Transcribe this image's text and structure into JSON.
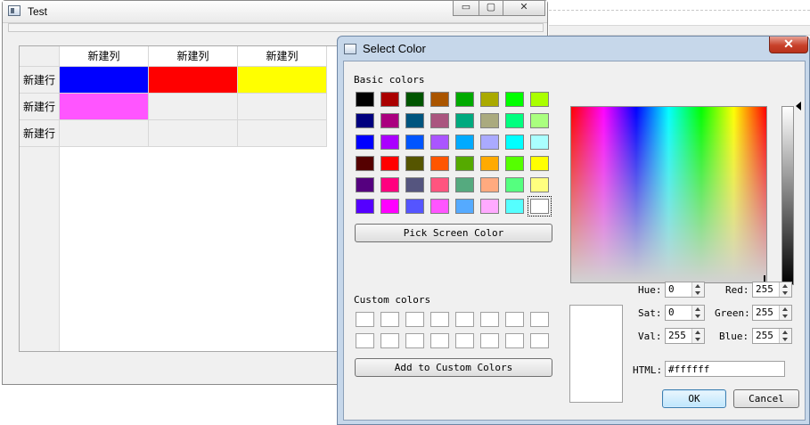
{
  "main_window": {
    "title": "Test",
    "controls": {
      "minimize": "▭",
      "maximize": "▢",
      "close": "✕"
    },
    "table": {
      "columns": [
        "新建列",
        "新建列",
        "新建列"
      ],
      "rows": [
        {
          "label": "新建行",
          "cells": [
            "#0000ff",
            "#ff0000",
            "#ffff00"
          ]
        },
        {
          "label": "新建行",
          "cells": [
            "#ff55ff",
            "",
            ""
          ]
        },
        {
          "label": "新建行",
          "cells": [
            "",
            "",
            ""
          ]
        }
      ]
    }
  },
  "dialog": {
    "title": "Select Color",
    "close": "✕",
    "basic_colors_label": "Basic colors",
    "basic_colors": [
      "#000000",
      "#aa0000",
      "#005500",
      "#aa5500",
      "#00aa00",
      "#aaaa00",
      "#00ff00",
      "#aaff00",
      "#00007f",
      "#aa007f",
      "#00557f",
      "#aa557f",
      "#00aa7f",
      "#aaaa7f",
      "#00ff7f",
      "#aaff7f",
      "#0000ff",
      "#aa00ff",
      "#0055ff",
      "#aa55ff",
      "#00aaff",
      "#aaaaff",
      "#00ffff",
      "#aaffff",
      "#550000",
      "#ff0000",
      "#555500",
      "#ff5500",
      "#55aa00",
      "#ffaa00",
      "#55ff00",
      "#ffff00",
      "#55007f",
      "#ff007f",
      "#55557f",
      "#ff557f",
      "#55aa7f",
      "#ffaa7f",
      "#55ff7f",
      "#ffff7f",
      "#5500ff",
      "#ff00ff",
      "#5555ff",
      "#ff55ff",
      "#55aaff",
      "#ffaaff",
      "#55ffff",
      "#ffffff"
    ],
    "pick_screen_color": "Pick Screen Color",
    "custom_colors_label": "Custom colors",
    "add_custom_colors": "Add to Custom Colors",
    "fields": {
      "hue": {
        "label": "Hue:",
        "value": "0"
      },
      "sat": {
        "label": "Sat:",
        "value": "0"
      },
      "val": {
        "label": "Val:",
        "value": "255"
      },
      "red": {
        "label": "Red:",
        "value": "255"
      },
      "green": {
        "label": "Green:",
        "value": "255"
      },
      "blue": {
        "label": "Blue:",
        "value": "255"
      }
    },
    "html_label": "HTML:",
    "html_value": "#ffffff",
    "ok": "OK",
    "cancel": "Cancel",
    "current_color": "#ffffff"
  }
}
